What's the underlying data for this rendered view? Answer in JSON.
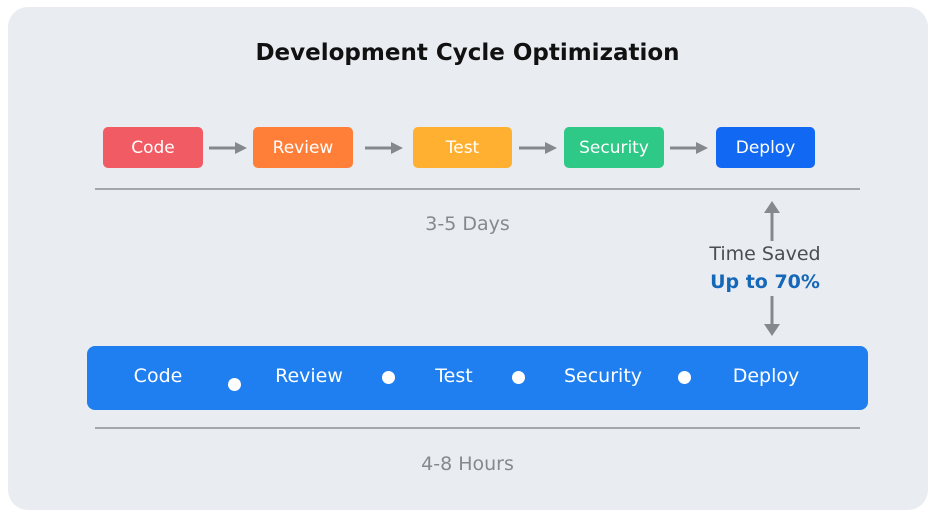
{
  "title": "Development Cycle Optimization",
  "traditional": {
    "steps": [
      {
        "label": "Code",
        "color": "#f15c64"
      },
      {
        "label": "Review",
        "color": "#ff7f39"
      },
      {
        "label": "Test",
        "color": "#ffb031"
      },
      {
        "label": "Security",
        "color": "#2ec887"
      },
      {
        "label": "Deploy",
        "color": "#1168f2"
      }
    ],
    "duration": "3-5 Days"
  },
  "time_saved": {
    "label": "Time Saved",
    "value": "Up to 70%"
  },
  "optimized": {
    "steps": [
      "Code",
      "Review",
      "Test",
      "Security",
      "Deploy"
    ],
    "duration": "4-8 Hours",
    "bar_color": "#1f7ff0"
  }
}
